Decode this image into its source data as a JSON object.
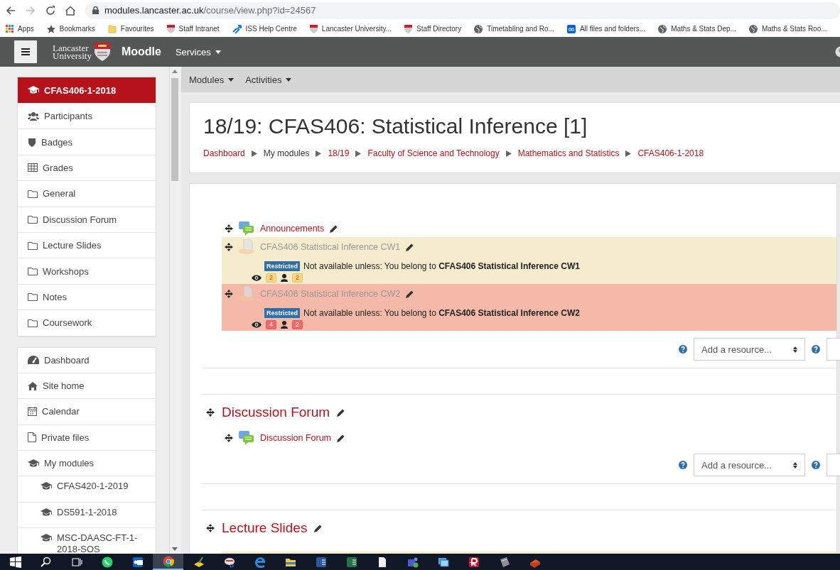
{
  "browser": {
    "url_host": "modules.lancaster.ac.uk",
    "url_path": "/course/view.php?id=24567",
    "bookmarks": [
      {
        "kind": "apps",
        "label": "Apps"
      },
      {
        "kind": "star",
        "label": "Bookmarks"
      },
      {
        "kind": "folder",
        "label": "Favourites"
      },
      {
        "kind": "crest",
        "label": "Staff Intranet"
      },
      {
        "kind": "arrows",
        "label": "ISS Help Centre"
      },
      {
        "kind": "crest",
        "label": "Lancaster University..."
      },
      {
        "kind": "crest",
        "label": "Staff Directory"
      },
      {
        "kind": "globe",
        "label": "Timetabling and Ro..."
      },
      {
        "kind": "box",
        "label": "All files and folders..."
      },
      {
        "kind": "globe",
        "label": "Maths & Stats Dep..."
      },
      {
        "kind": "globe",
        "label": "Maths & Stats Roo..."
      }
    ]
  },
  "navbar": {
    "logo_lines": [
      "Lancaster",
      "University"
    ],
    "brand": "Moodle",
    "menu": "Services"
  },
  "sidebar": {
    "course_items": [
      {
        "kind": "course",
        "label": "CFAS406-1-2018",
        "selected": true
      },
      {
        "kind": "people",
        "label": "Participants",
        "selected": false
      },
      {
        "kind": "shield",
        "label": "Badges",
        "selected": false
      },
      {
        "kind": "grid",
        "label": "Grades",
        "selected": false
      },
      {
        "kind": "folder",
        "label": "General",
        "selected": false
      },
      {
        "kind": "folder",
        "label": "Discussion Forum",
        "selected": false
      },
      {
        "kind": "folder",
        "label": "Lecture Slides",
        "selected": false
      },
      {
        "kind": "folder",
        "label": "Workshops",
        "selected": false
      },
      {
        "kind": "folder",
        "label": "Notes",
        "selected": false
      },
      {
        "kind": "folder",
        "label": "Coursework",
        "selected": false
      }
    ],
    "site_items": [
      {
        "kind": "dashboard",
        "label": "Dashboard",
        "selected": false
      },
      {
        "kind": "home",
        "label": "Site home",
        "selected": false
      },
      {
        "kind": "calendar",
        "label": "Calendar",
        "selected": false
      },
      {
        "kind": "file",
        "label": "Private files",
        "selected": false
      },
      {
        "kind": "course",
        "label": "My modules",
        "selected": false,
        "children": [
          {
            "kind": "course",
            "label": "CFAS420-1-2019",
            "selected": false
          },
          {
            "kind": "course",
            "label": "DS591-1-2018",
            "selected": false
          },
          {
            "kind": "course",
            "label": "MSC-DAASC-FT-1-2018-SOS",
            "selected": false
          }
        ]
      }
    ]
  },
  "secondary_nav": [
    "Modules",
    "Activities"
  ],
  "header": {
    "title": "18/19: CFAS406: Statistical Inference [1]",
    "breadcrumbs": [
      {
        "label": "Dashboard",
        "link": true
      },
      {
        "label": "My modules",
        "link": false
      },
      {
        "label": "18/19",
        "link": true
      },
      {
        "label": "Faculty of Science and Technology",
        "link": true
      },
      {
        "label": "Mathematics and Statistics",
        "link": true
      },
      {
        "label": "CFAS406-1-2018",
        "link": true
      }
    ]
  },
  "sections": [
    {
      "activities": [
        {
          "kind": "forum",
          "title": "Announcements",
          "hidden": false
        },
        {
          "kind": "assignment",
          "title": "CFAS406 Statistical Inference CW1",
          "hidden": true,
          "color": "#f5ebcd",
          "restriction": {
            "badge": "Restricted",
            "text": "Not available unless: You belong to **CFAS406 Statistical Inference CW1**"
          },
          "counts": [
            {
              "kind": "views",
              "value": "2",
              "color": "#f9d77e"
            },
            {
              "kind": "users",
              "value": "2",
              "color": "#f9d77e"
            }
          ]
        },
        {
          "kind": "assignment",
          "title": "CFAS406 Statistical Inference CW2",
          "hidden": true,
          "color": "#f4b9a8",
          "restriction": {
            "badge": "Restricted",
            "text": "Not available unless: You belong to **CFAS406 Statistical Inference CW2**"
          },
          "counts": [
            {
              "kind": "views",
              "value": "4",
              "color": "#ef6b6b"
            },
            {
              "kind": "users",
              "value": "2",
              "color": "#ef6b6b"
            }
          ]
        }
      ],
      "add_resource": "Add a resource..."
    },
    {
      "title": "Discussion Forum",
      "activities": [
        {
          "kind": "forum",
          "title": "Discussion Forum",
          "hidden": false
        }
      ],
      "add_resource": "Add a resource..."
    },
    {
      "title": "Lecture Slides",
      "activities": [
        {
          "kind": "cut",
          "color": "#f5ebcd"
        }
      ]
    }
  ],
  "taskbar": {
    "apps": [
      {
        "kind": "start",
        "selected": false
      },
      {
        "kind": "search",
        "selected": false
      },
      {
        "kind": "taskview",
        "selected": false
      },
      {
        "kind": "chat",
        "selected": false
      },
      {
        "kind": "mail",
        "selected": false
      },
      {
        "kind": "browser",
        "selected": true
      },
      {
        "kind": "paint",
        "selected": false
      },
      {
        "kind": "snip",
        "selected": false
      },
      {
        "kind": "edge",
        "selected": false
      },
      {
        "kind": "explorer",
        "selected": false
      },
      {
        "kind": "word",
        "selected": false
      },
      {
        "kind": "excel",
        "selected": false
      },
      {
        "kind": "doc",
        "selected": false
      },
      {
        "kind": "teams",
        "selected": false
      },
      {
        "kind": "photos",
        "selected": false
      },
      {
        "kind": "reader",
        "selected": false
      },
      {
        "kind": "notebook",
        "selected": false
      },
      {
        "kind": "book",
        "selected": false
      }
    ]
  }
}
